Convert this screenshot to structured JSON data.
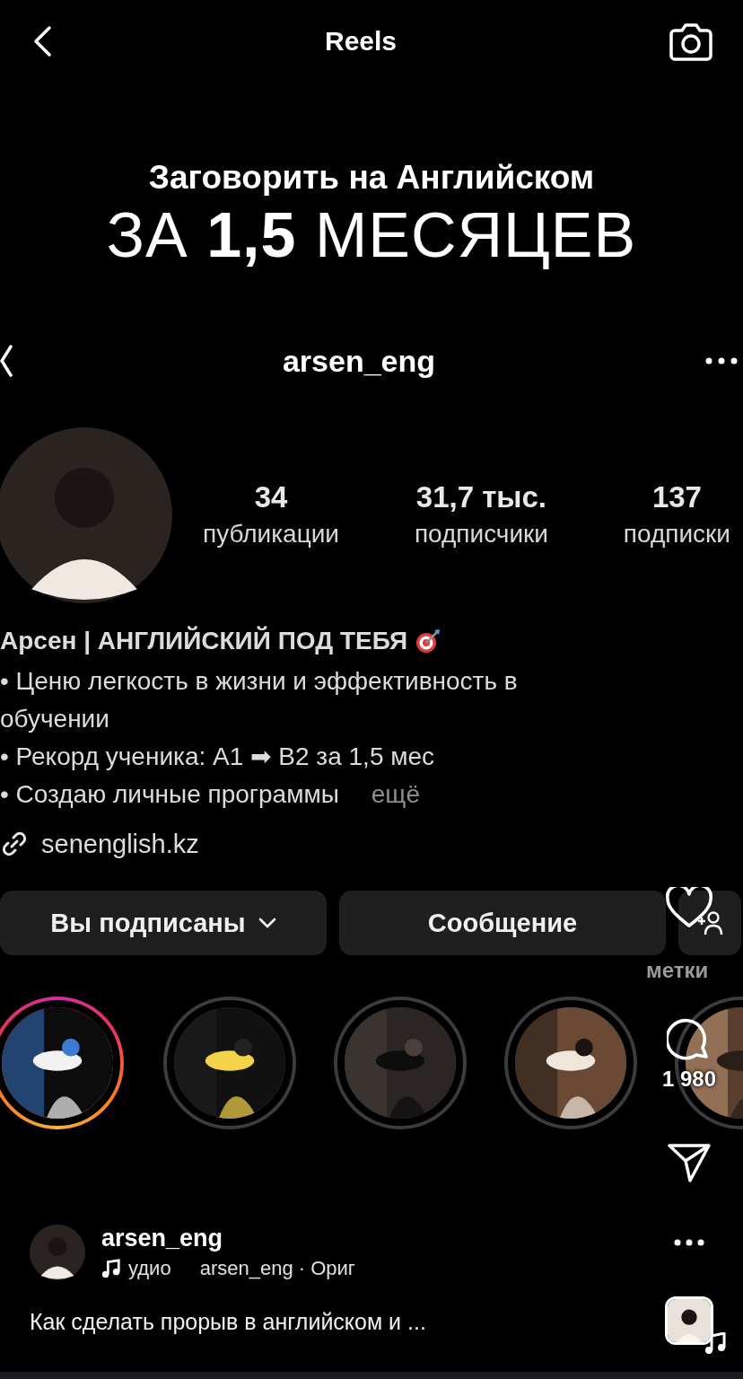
{
  "top_bar": {
    "title": "Reels"
  },
  "video": {
    "headline": [
      "Заговорить на Английском",
      "ЗА **1,5** МЕСЯЦЕВ"
    ],
    "profile": {
      "username": "arsen_eng",
      "stats": [
        {
          "value": "34",
          "label": "публикации"
        },
        {
          "value": "31,7 тыс.",
          "label": "подписчики"
        },
        {
          "value": "137",
          "label": "подписки"
        }
      ],
      "bio_name": "Арсен | АНГЛИЙСКИЙ ПОД ТЕБЯ",
      "bio_lines": [
        "• Ценю легкость в жизни и эффективность в",
        "обучении",
        "• Рекорд ученика: A1 ➡ B2 за 1,5 мес",
        "• Создаю личные программы"
      ],
      "more": "ещё",
      "link": "senenglish.kz",
      "buttons": [
        {
          "kind": "dropdown",
          "label": "Вы подписаны"
        },
        {
          "kind": "plain",
          "label": "Сообщение"
        },
        {
          "kind": "add-person"
        }
      ],
      "tab_hint": "метки",
      "highlights": [
        {
          "unseen": true
        },
        {
          "unseen": false
        },
        {
          "unseen": false
        },
        {
          "unseen": false
        },
        {
          "unseen": false
        }
      ]
    }
  },
  "actions": {
    "liked": false,
    "comments": "1 980"
  },
  "reel": {
    "username": "arsen_eng",
    "audio_title": "удио",
    "audio_source": "arsen_eng · Ориг",
    "caption": "Как сделать прорыв в английском и ..."
  }
}
